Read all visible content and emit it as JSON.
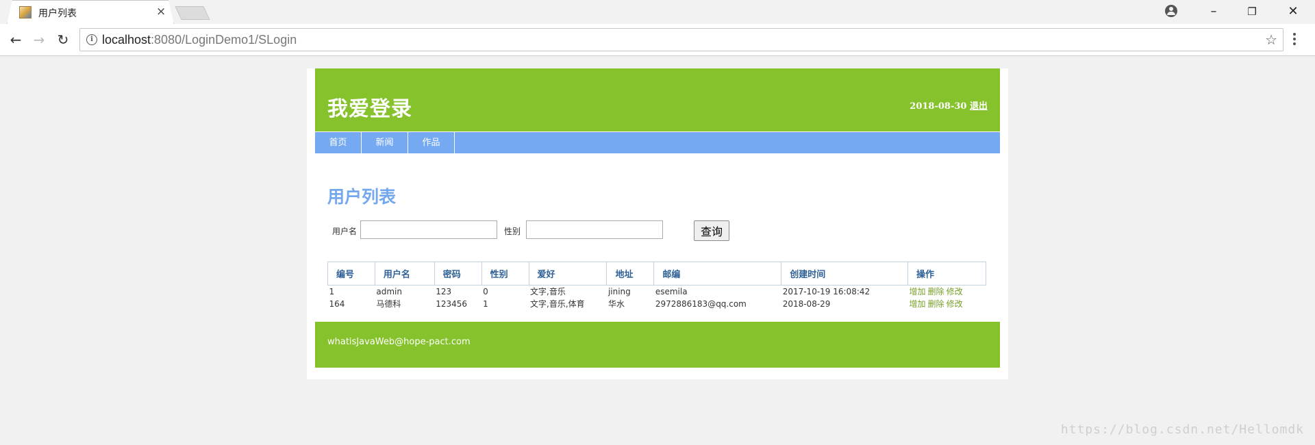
{
  "browser": {
    "tab_title": "用户列表",
    "close_glyph": "×",
    "minimize_glyph": "–",
    "restore_glyph": "❐",
    "window_close_glyph": "✕",
    "back_glyph": "←",
    "forward_glyph": "→",
    "reload_glyph": "↻",
    "star_glyph": "☆",
    "info_glyph": "i",
    "url_host": "localhost",
    "url_rest": ":8080/LoginDemo1/SLogin",
    "icons": [
      "favicon-icon",
      "close-icon",
      "profile-icon",
      "minimize-icon",
      "restore-icon",
      "window-close-icon",
      "back-icon",
      "forward-icon",
      "reload-icon",
      "info-icon",
      "star-icon",
      "menu-icon"
    ]
  },
  "header": {
    "site_title": "我爱登录",
    "date": "2018-08-30",
    "logout": "退出"
  },
  "nav": {
    "items": [
      "首页",
      "新闻",
      "作品"
    ]
  },
  "main": {
    "title": "用户列表",
    "search": {
      "username_label": "用户名",
      "username_value": "",
      "gender_label": "性别",
      "gender_value": "",
      "query_button": "查询"
    },
    "table": {
      "headers": [
        "编号",
        "用户名",
        "密码",
        "性别",
        "爱好",
        "地址",
        "邮编",
        "创建时间",
        "操作"
      ],
      "rows": [
        {
          "cells": [
            "1",
            "admin",
            "123",
            "0",
            "文字,音乐",
            "jining",
            "esemila",
            "2017-10-19 16:08:42"
          ],
          "actions": [
            "增加",
            "删除",
            "修改"
          ]
        },
        {
          "cells": [
            "164",
            "马德科",
            "123456",
            "1",
            "文字,音乐,体育",
            "华水",
            "2972886183@qq.com",
            "2018-08-29"
          ],
          "actions": [
            "增加",
            "删除",
            "修改"
          ]
        }
      ]
    }
  },
  "footer": {
    "email": "whatisJavaWeb@hope-pact.com"
  },
  "watermark": "https://blog.csdn.net/Hellomdk",
  "colors": {
    "header_green": "#86c22b",
    "nav_blue": "#75aaf2",
    "title_blue": "#73a8ee",
    "action_green": "#78a02a"
  }
}
